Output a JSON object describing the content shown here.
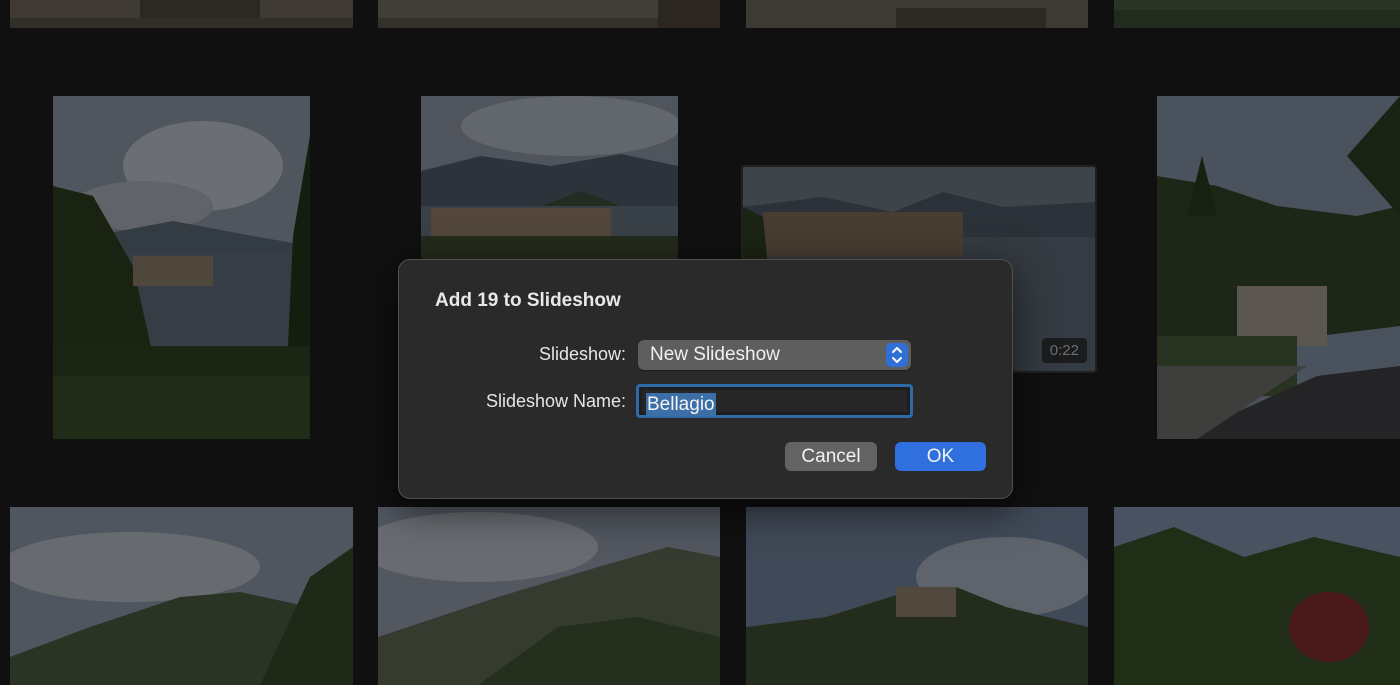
{
  "dialog": {
    "title": "Add 19 to Slideshow",
    "slideshow_label": "Slideshow:",
    "slideshow_value": "New Slideshow",
    "name_label": "Slideshow Name:",
    "name_value": "Bellagio",
    "cancel_label": "Cancel",
    "ok_label": "OK"
  },
  "grid": {
    "video_duration": "0:22"
  },
  "colors": {
    "accent": "#2f6fde",
    "dialog_bg": "#2a2a2a",
    "page_bg": "#1c1c1c"
  }
}
